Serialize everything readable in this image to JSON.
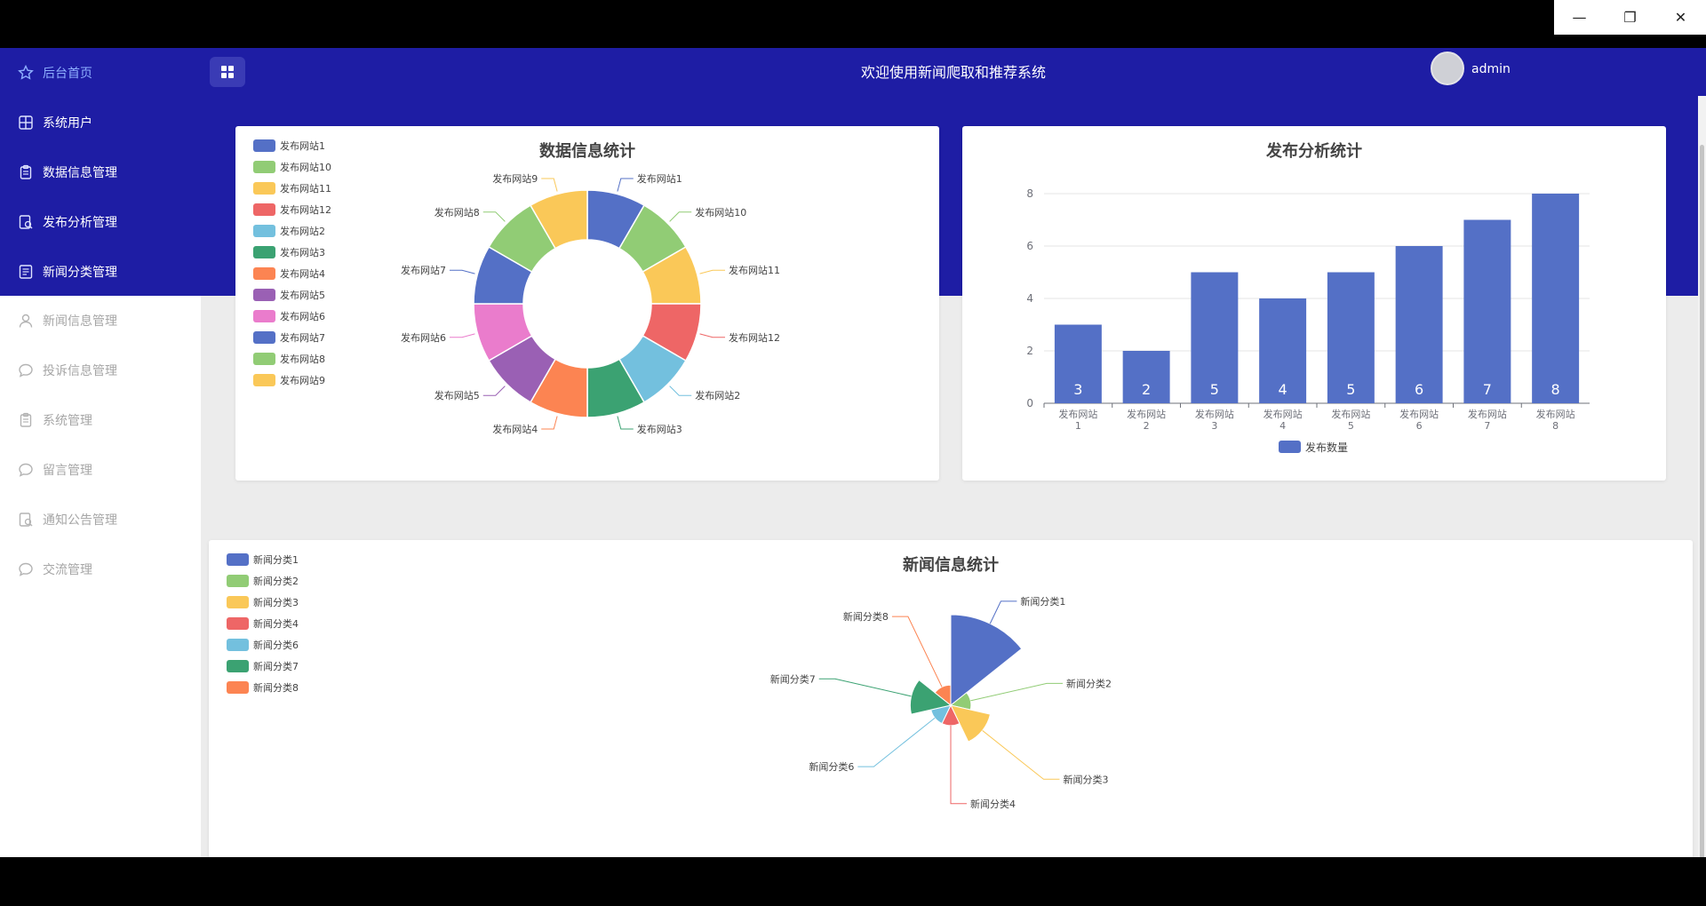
{
  "window_controls": {
    "minimize": "—",
    "restore": "❐",
    "close": "✕"
  },
  "header": {
    "welcome": "欢迎使用新闻爬取和推荐系统",
    "username": "admin"
  },
  "sidebar": {
    "items": [
      {
        "label": "后台首页",
        "icon": "star-icon",
        "active": true
      },
      {
        "label": "系统用户",
        "icon": "grid-icon"
      },
      {
        "label": "数据信息管理",
        "icon": "clipboard-icon"
      },
      {
        "label": "发布分析管理",
        "icon": "doc-search-icon"
      },
      {
        "label": "新闻分类管理",
        "icon": "doc-list-icon"
      },
      {
        "label": "新闻信息管理",
        "icon": "user-icon"
      },
      {
        "label": "投诉信息管理",
        "icon": "chat-icon"
      },
      {
        "label": "系统管理",
        "icon": "clipboard-icon"
      },
      {
        "label": "留言管理",
        "icon": "chat-icon"
      },
      {
        "label": "通知公告管理",
        "icon": "doc-search-icon"
      },
      {
        "label": "交流管理",
        "icon": "chat-icon"
      }
    ]
  },
  "colors": {
    "nav": "#1e1da4",
    "palette": [
      "#5470c6",
      "#91cc75",
      "#fac858",
      "#ee6666",
      "#73c0de",
      "#3ba272",
      "#fc8452",
      "#9a60b4",
      "#ea7ccc"
    ]
  },
  "chart_data": [
    {
      "type": "pie",
      "variant": "donut",
      "title": "数据信息统计",
      "legend_position": "top-left",
      "categories": [
        "发布网站1",
        "发布网站10",
        "发布网站11",
        "发布网站12",
        "发布网站2",
        "发布网站3",
        "发布网站4",
        "发布网站5",
        "发布网站6",
        "发布网站7",
        "发布网站8",
        "发布网站9"
      ],
      "values": [
        1,
        1,
        1,
        1,
        1,
        1,
        1,
        1,
        1,
        1,
        1,
        1
      ]
    },
    {
      "type": "bar",
      "title": "发布分析统计",
      "categories": [
        "发布网站1",
        "发布网站2",
        "发布网站3",
        "发布网站4",
        "发布网站5",
        "发布网站6",
        "发布网站7",
        "发布网站8"
      ],
      "series": [
        {
          "name": "发布数量",
          "values": [
            3,
            2,
            5,
            4,
            5,
            6,
            7,
            8
          ]
        }
      ],
      "ylim": [
        0,
        8
      ],
      "yticks": [
        0,
        2,
        4,
        6,
        8
      ],
      "grid": true,
      "legend_position": "bottom"
    },
    {
      "type": "pie",
      "variant": "rose",
      "title": "新闻信息统计",
      "legend_position": "top-left",
      "categories": [
        "新闻分类1",
        "新闻分类2",
        "新闻分类3",
        "新闻分类4",
        "新闻分类6",
        "新闻分类7",
        "新闻分类8"
      ],
      "values": [
        20,
        1,
        4,
        1,
        1,
        4,
        1
      ]
    }
  ]
}
